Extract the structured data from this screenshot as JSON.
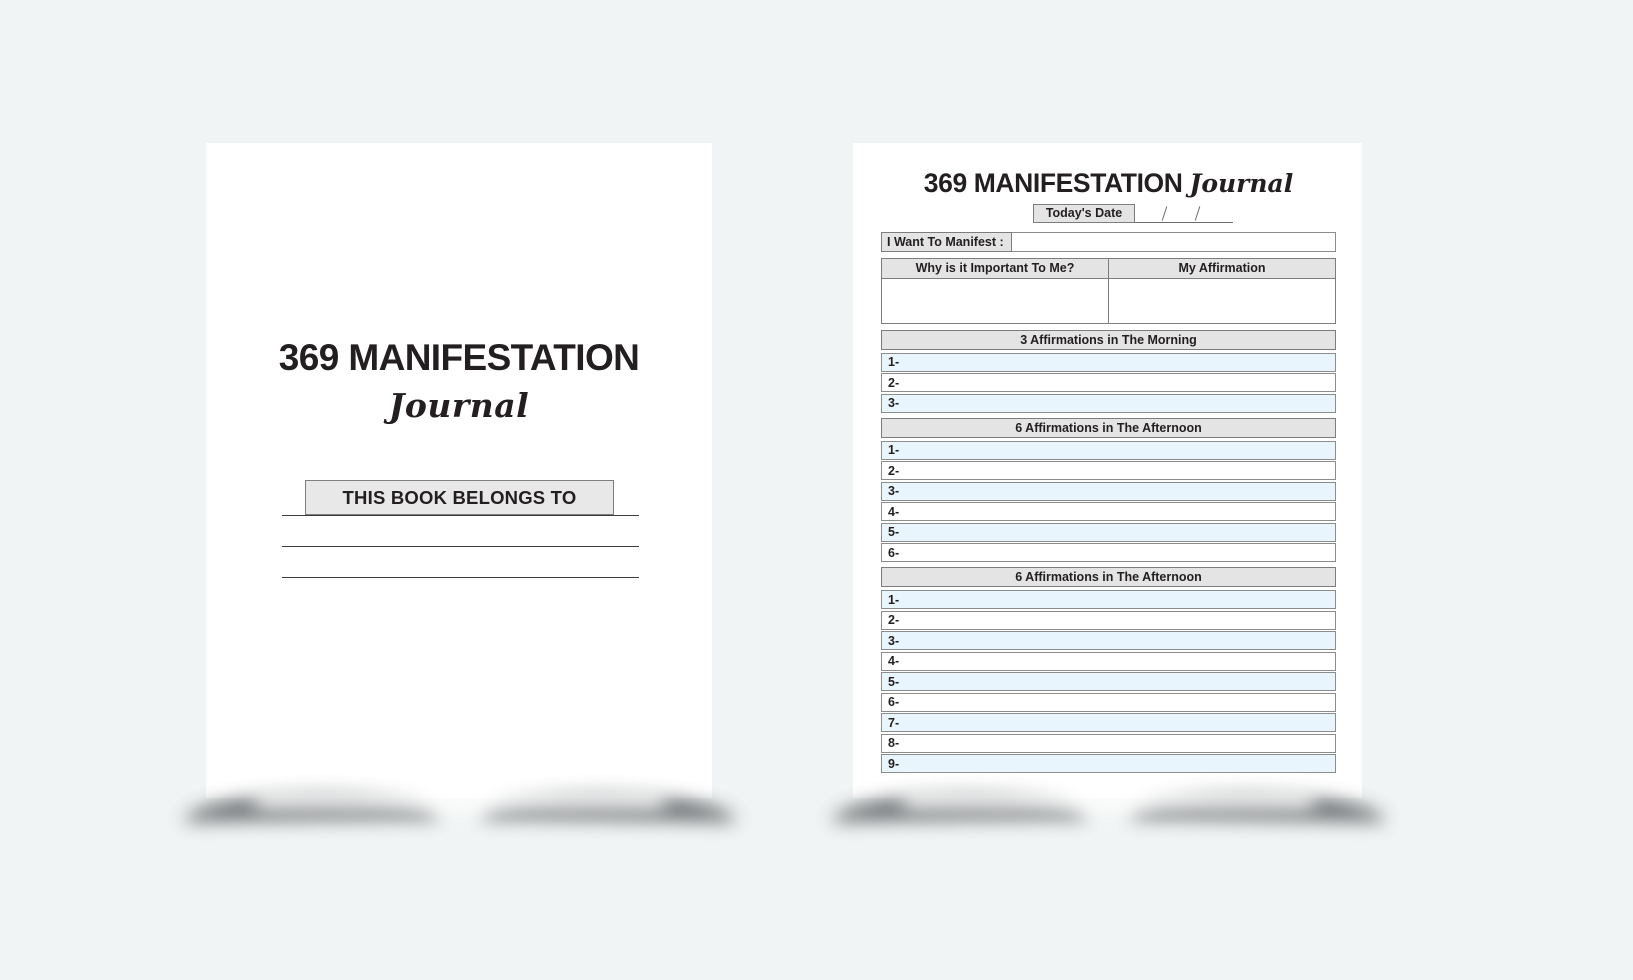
{
  "background_color": "#f1f4f4",
  "cover": {
    "title_main": "369 MANIFESTATION",
    "title_script": "Journal",
    "belongs_label": "THIS BOOK BELONGS TO"
  },
  "interior": {
    "title_bold": "369 MANIFESTATION",
    "title_script": "Journal",
    "date_label": "Today's Date",
    "manifest_label": "I Want To Manifest :",
    "columns": [
      {
        "header": "Why is it Important To Me?"
      },
      {
        "header": "My Affirmation"
      }
    ],
    "sections": [
      {
        "header": "3 Affirmations in The Morning",
        "rows": [
          "1-",
          "2-",
          "3-"
        ]
      },
      {
        "header": "6 Affirmations in The Afternoon",
        "rows": [
          "1-",
          "2-",
          "3-",
          "4-",
          "5-",
          "6-"
        ]
      },
      {
        "header": "6 Affirmations in The Afternoon",
        "rows": [
          "1-",
          "2-",
          "3-",
          "4-",
          "5-",
          "6-",
          "7-",
          "8-",
          "9-"
        ]
      }
    ]
  },
  "colors": {
    "header_fill": "#e4e4e4",
    "row_tint": "#e9f5fc",
    "border": "#7d7d7d",
    "text": "#231f20"
  }
}
